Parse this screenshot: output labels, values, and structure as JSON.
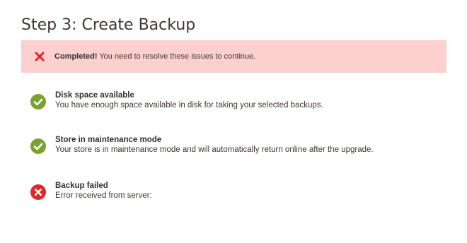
{
  "page": {
    "title": "Step 3: Create Backup"
  },
  "alert": {
    "icon": "x-icon",
    "strong": "Completed!",
    "message": " You need to resolve these issues to continue.",
    "color_bg": "#fcd0cf",
    "color_icon": "#e22626"
  },
  "checks": [
    {
      "status": "success",
      "icon": "check-circle-icon",
      "title": "Disk space available",
      "description": "You have enough space available in disk for taking your selected backups."
    },
    {
      "status": "success",
      "icon": "check-circle-icon",
      "title": "Store in maintenance mode",
      "description": "Your store is in maintenance mode and will automatically return online after the upgrade."
    },
    {
      "status": "error",
      "icon": "error-circle-icon",
      "title": "Backup failed",
      "description": "Error received from server:"
    }
  ],
  "colors": {
    "success": "#79a22e",
    "error": "#e22626"
  }
}
